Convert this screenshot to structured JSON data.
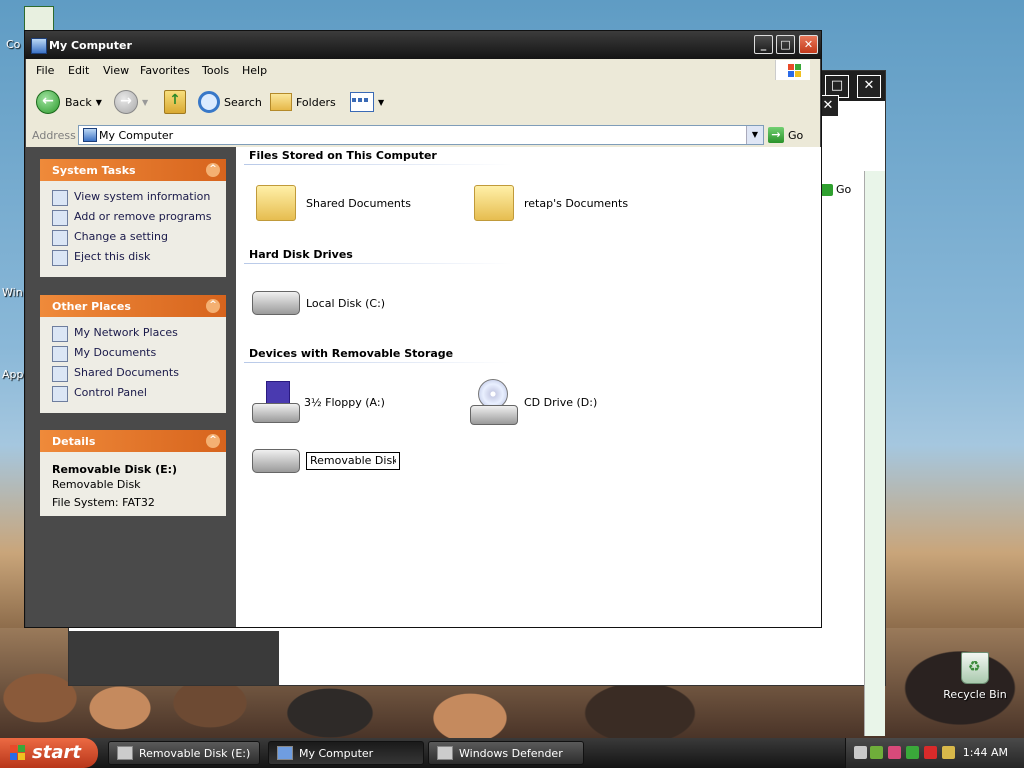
{
  "desktop": {
    "left_labels": [
      "Co",
      "Win",
      "App"
    ],
    "recycle_bin": "Recycle Bin"
  },
  "background_window": {
    "go_label": "Go"
  },
  "window": {
    "title": "My Computer",
    "menu": [
      "File",
      "Edit",
      "View",
      "Favorites",
      "Tools",
      "Help"
    ],
    "toolbar": {
      "back": "Back",
      "search": "Search",
      "folders": "Folders"
    },
    "address_label": "Address",
    "address_value": "My Computer",
    "go_label": "Go"
  },
  "left_pane": {
    "system_tasks": {
      "title": "System Tasks",
      "items": [
        "View system information",
        "Add or remove programs",
        "Change a setting",
        "Eject this disk"
      ]
    },
    "other_places": {
      "title": "Other Places",
      "items": [
        "My Network Places",
        "My Documents",
        "Shared Documents",
        "Control Panel"
      ]
    },
    "details": {
      "title": "Details",
      "name": "Removable Disk (E:)",
      "type": "Removable Disk",
      "fs": "File System: FAT32"
    }
  },
  "content": {
    "sections": [
      "Files Stored on This Computer",
      "Hard Disk Drives",
      "Devices with Removable Storage"
    ],
    "files": [
      "Shared Documents",
      "retap's Documents"
    ],
    "drives": [
      "Local Disk (C:)"
    ],
    "removable": [
      "3½ Floppy (A:)",
      "CD Drive (D:)"
    ],
    "rename_value": "Removable Disk"
  },
  "taskbar": {
    "start": "start",
    "tasks": [
      "Removable Disk (E:)",
      "My Computer",
      "Windows Defender"
    ],
    "clock": "1:44 AM"
  },
  "colors": {
    "panel_header": "#d7641d",
    "left_pane_bg": "#4a4a4a",
    "titlebar": "#141414"
  }
}
